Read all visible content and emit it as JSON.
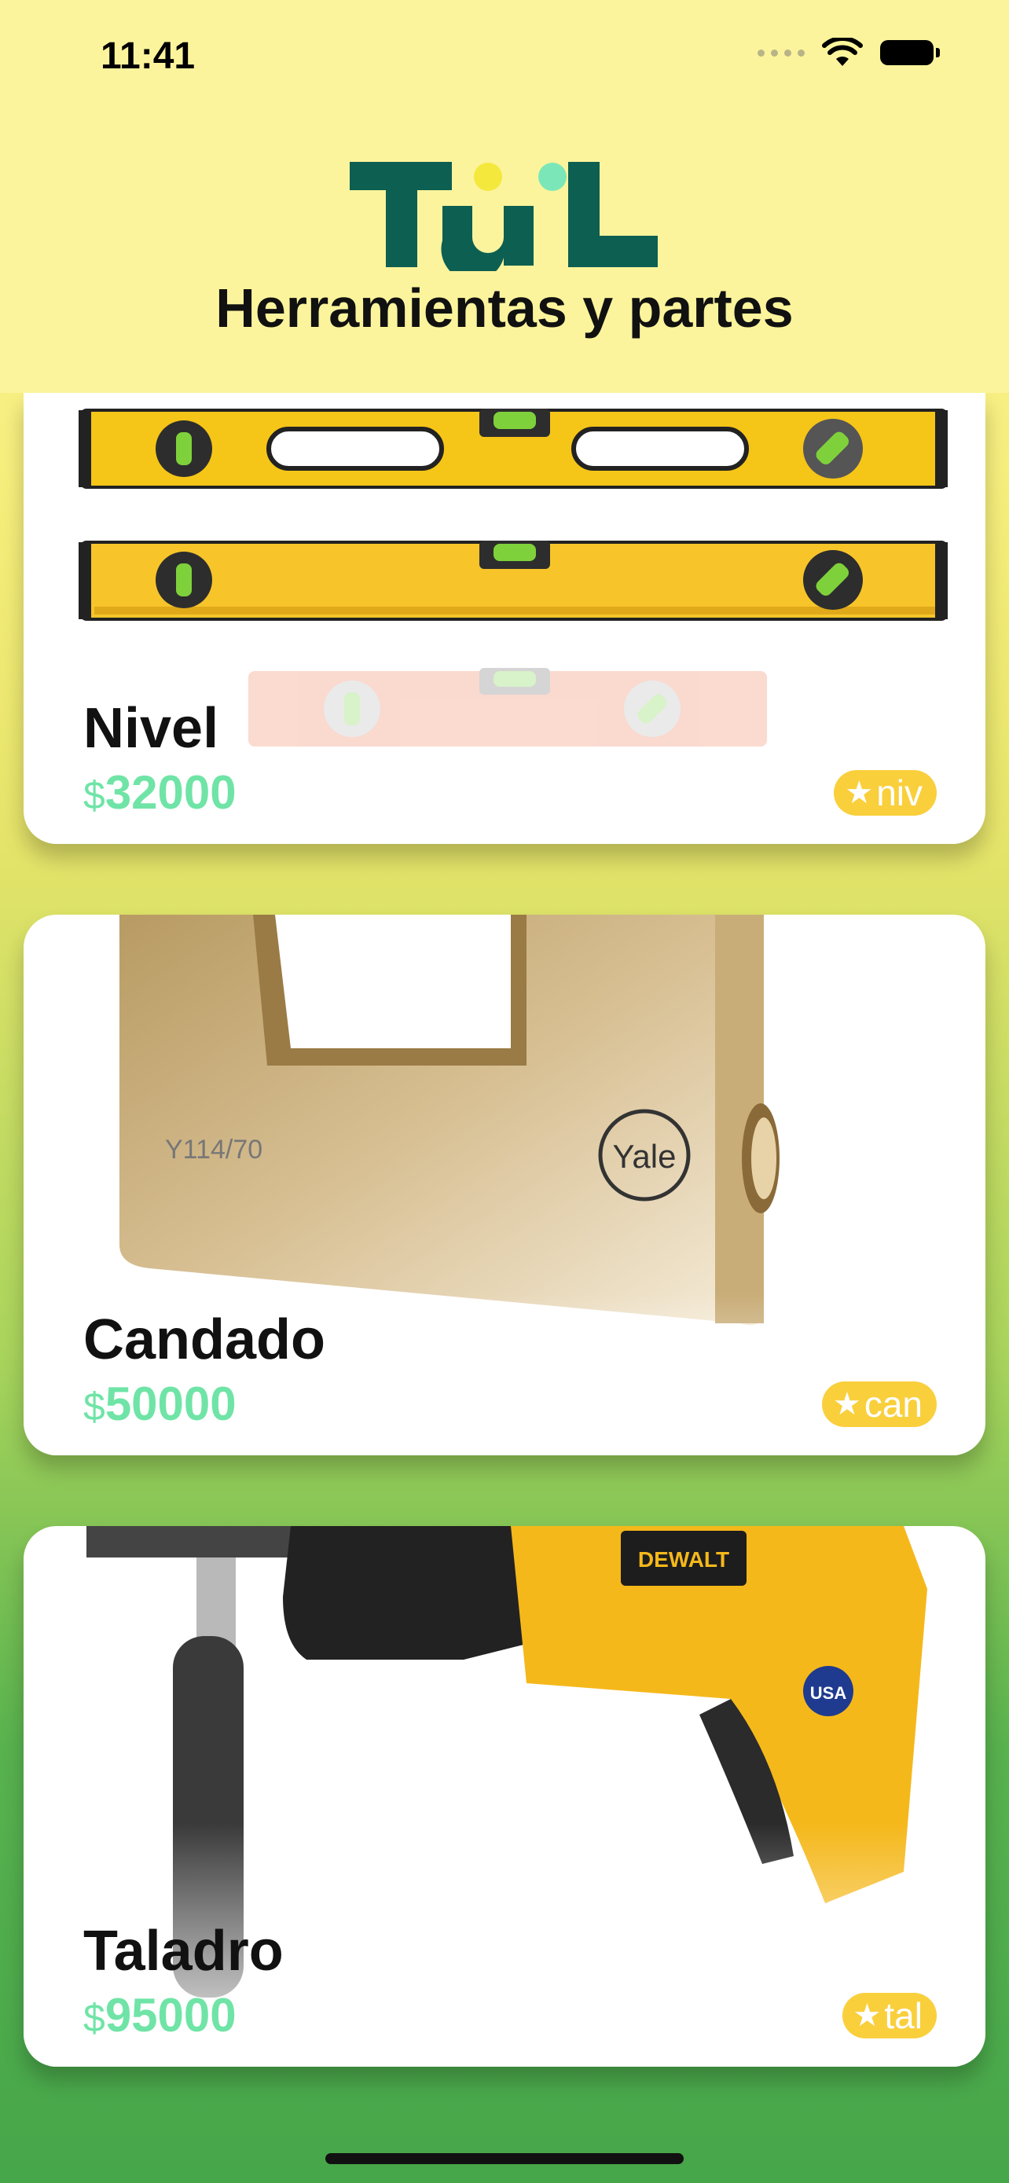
{
  "status_bar": {
    "time": "11:41"
  },
  "header": {
    "logo_text": "TüL",
    "subtitle": "Herramientas y partes"
  },
  "products": [
    {
      "title": "Nivel",
      "currency": "$",
      "price": "32000",
      "tag": "niv",
      "image": "spirit-level-photo"
    },
    {
      "title": "Candado",
      "currency": "$",
      "price": "50000",
      "tag": "can",
      "image": "padlock-photo",
      "brand": "Yale",
      "model": "Y114/70"
    },
    {
      "title": "Taladro",
      "currency": "$",
      "price": "95000",
      "tag": "tal",
      "image": "drill-photo",
      "brand": "DEWALT",
      "badge": "USA"
    }
  ],
  "colors": {
    "accent": "#6fe4a6",
    "tag": "#f9cf3c",
    "logo": "#0d5f52",
    "header_bg": "#fbf49c"
  }
}
